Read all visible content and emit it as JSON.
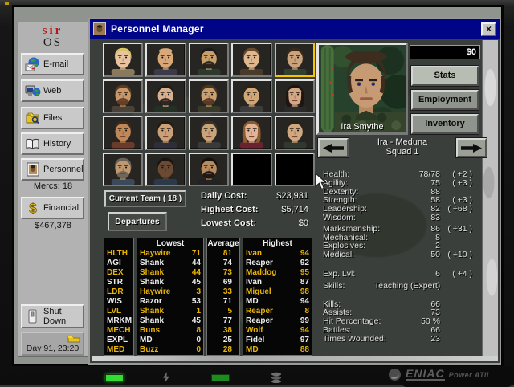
{
  "titlebar": {
    "title": "Personnel Manager",
    "close_glyph": "×"
  },
  "sidebar": {
    "logo_top": "sir",
    "logo_bottom": "OS",
    "email_label": "E-mail",
    "web_label": "Web",
    "files_label": "Files",
    "history_label": "History",
    "personnel_label": "Personnel",
    "personnel_sub": "Mercs: 18",
    "financial_label": "Financial",
    "financial_sub": "$467,378",
    "shutdown_label": "Shut Down",
    "clock": "Day 91, 23:20"
  },
  "roster": {
    "selected_index": 4,
    "empty_slots": 2,
    "portraits": [
      {
        "s": "#e8c4a0",
        "h": "#d8c468",
        "y": "short",
        "b": false,
        "t": "#8a7a5a"
      },
      {
        "s": "#d8a878",
        "h": "#caa070",
        "y": "bald",
        "b": false,
        "t": "#3a3a4a"
      },
      {
        "s": "#caa06a",
        "h": "#1a1a1a",
        "y": "short",
        "b": true,
        "t": "#2e3a2e"
      },
      {
        "s": "#e0b890",
        "h": "#6a4a2a",
        "y": "short",
        "b": false,
        "t": "#4a3a2a"
      },
      {
        "s": "#caa27c",
        "h": "#3a2a1a",
        "y": "short",
        "b": false,
        "t": "#31412e"
      },
      {
        "s": "#c89868",
        "h": "#5a3a20",
        "y": "short",
        "b": true,
        "t": "#4a4238"
      },
      {
        "s": "#d8b090",
        "h": "#1c1c1c",
        "y": "short",
        "b": true,
        "t": "#243024"
      },
      {
        "s": "#caa070",
        "h": "#4a3420",
        "y": "short",
        "b": true,
        "t": "#3a3a2a"
      },
      {
        "s": "#d0a878",
        "h": "#2a2018",
        "y": "short",
        "b": false,
        "t": "#3c3c3c"
      },
      {
        "s": "#d4a884",
        "h": "#1e1410",
        "y": "long",
        "b": false,
        "t": "#2a2a2a"
      },
      {
        "s": "#c08858",
        "h": "#3a2a18",
        "y": "short",
        "b": false,
        "t": "#6a3a2a"
      },
      {
        "s": "#caa078",
        "h": "#241a12",
        "y": "short",
        "b": false,
        "t": "#2e2e3a"
      },
      {
        "s": "#c8a478",
        "h": "#3a3028",
        "y": "short",
        "b": false,
        "t": "#3a3a3a"
      },
      {
        "s": "#e0b494",
        "h": "#8a5a30",
        "y": "long",
        "b": false,
        "t": "#6a2230"
      },
      {
        "s": "#d0a880",
        "h": "#2a2218",
        "y": "short",
        "b": false,
        "t": "#303830"
      },
      {
        "s": "#c09870",
        "h": "#6a6258",
        "y": "short",
        "b": true,
        "t": "#3a4a5a"
      },
      {
        "s": "#6a4a32",
        "h": "#1a140e",
        "y": "short",
        "b": false,
        "t": "#2a3a4a"
      },
      {
        "s": "#b88a62",
        "h": "#14100c",
        "y": "short",
        "b": true,
        "t": "#222222"
      }
    ]
  },
  "team": {
    "current_label": "Current Team ( 18 )",
    "departures_label": "Departures",
    "costs": [
      {
        "label": "Daily Cost:",
        "value": "$23,931"
      },
      {
        "label": "Highest Cost:",
        "value": "$5,714"
      },
      {
        "label": "Lowest Cost:",
        "value": "$0"
      }
    ]
  },
  "compare_table": {
    "headers": [
      "Lowest",
      "Average",
      "Highest"
    ],
    "rows": [
      {
        "stat": "HLTH",
        "low_name": "Haywire",
        "low": "71",
        "avg": "81",
        "high_name": "Ivan",
        "high": "94"
      },
      {
        "stat": "AGI",
        "low_name": "Shank",
        "low": "44",
        "avg": "74",
        "high_name": "Reaper",
        "high": "92"
      },
      {
        "stat": "DEX",
        "low_name": "Shank",
        "low": "44",
        "avg": "73",
        "high_name": "Maddog",
        "high": "95"
      },
      {
        "stat": "STR",
        "low_name": "Shank",
        "low": "45",
        "avg": "69",
        "high_name": "Ivan",
        "high": "87"
      },
      {
        "stat": "LDR",
        "low_name": "Haywire",
        "low": "3",
        "avg": "33",
        "high_name": "Miguel",
        "high": "98"
      },
      {
        "stat": "WIS",
        "low_name": "Razor",
        "low": "53",
        "avg": "71",
        "high_name": "MD",
        "high": "94"
      },
      {
        "stat": "LVL",
        "low_name": "Shank",
        "low": "1",
        "avg": "5",
        "high_name": "Reaper",
        "high": "8"
      },
      {
        "stat": "MRKM",
        "low_name": "Shank",
        "low": "45",
        "avg": "77",
        "high_name": "Reaper",
        "high": "99"
      },
      {
        "stat": "MECH",
        "low_name": "Buns",
        "low": "8",
        "avg": "38",
        "high_name": "Wolf",
        "high": "94"
      },
      {
        "stat": "EXPL",
        "low_name": "MD",
        "low": "0",
        "avg": "25",
        "high_name": "Fidel",
        "high": "97"
      },
      {
        "stat": "MED",
        "low_name": "Buzz",
        "low": "0",
        "avg": "28",
        "high_name": "MD",
        "high": "88"
      }
    ]
  },
  "detail": {
    "balance": "$0",
    "buttons": [
      "Stats",
      "Employment",
      "Inventory"
    ],
    "active_button": 0,
    "portrait_name": "Ira Smythe",
    "location_line1": "Ira - Meduna",
    "location_line2": "Squad 1",
    "stat_groups": [
      [
        {
          "label": "Health:",
          "value": "78/78",
          "bonus": "( +2 )"
        },
        {
          "label": "Agility:",
          "value": "75",
          "bonus": "( +3 )"
        },
        {
          "label": "Dexterity:",
          "value": "88",
          "bonus": ""
        },
        {
          "label": "Strength:",
          "value": "58",
          "bonus": "( +3 )"
        },
        {
          "label": "Leadership:",
          "value": "82",
          "bonus": "( +68 )"
        },
        {
          "label": "Wisdom:",
          "value": "83",
          "bonus": ""
        }
      ],
      [
        {
          "label": "Marksmanship:",
          "value": "86",
          "bonus": "( +31 )"
        },
        {
          "label": "Mechanical:",
          "value": "8",
          "bonus": ""
        },
        {
          "label": "Explosives:",
          "value": "2",
          "bonus": ""
        },
        {
          "label": "Medical:",
          "value": "50",
          "bonus": "( +10 )"
        }
      ],
      [
        {
          "label": "Exp. Lvl:",
          "value": "6",
          "bonus": "( +4 )"
        }
      ],
      [
        {
          "label": "Skills:",
          "value": "Teaching (Expert)",
          "bonus": "",
          "inline": true
        }
      ],
      [
        {
          "label": "Kills:",
          "value": "66",
          "bonus": ""
        },
        {
          "label": "Assists:",
          "value": "73",
          "bonus": ""
        },
        {
          "label": "Hit Percentage:",
          "value": "50 %",
          "bonus": ""
        },
        {
          "label": "Battles:",
          "value": "66",
          "bonus": ""
        },
        {
          "label": "Times Wounded:",
          "value": "23",
          "bonus": ""
        }
      ]
    ]
  },
  "footer": {
    "brand": "ENIAC",
    "brand_sub": "Power ATii"
  }
}
